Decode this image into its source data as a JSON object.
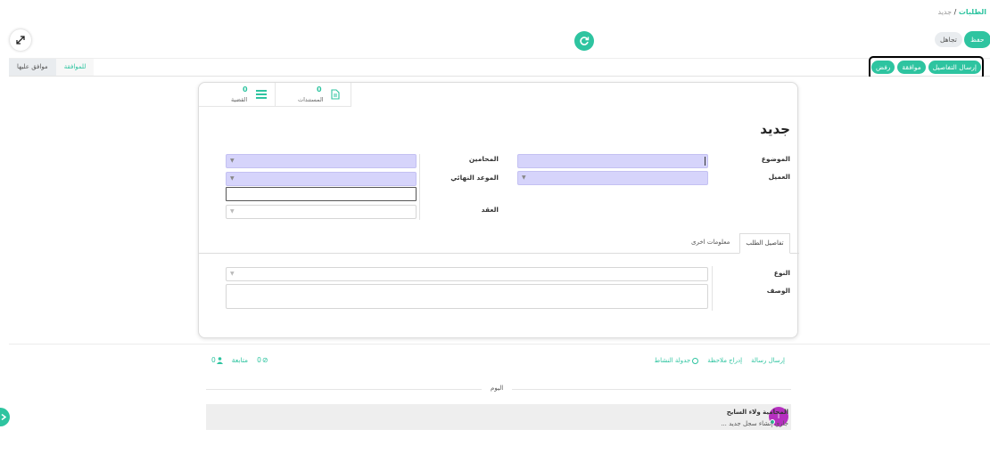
{
  "breadcrumb": {
    "parent": "الطلبات",
    "separator": "/",
    "current": "جديد"
  },
  "toolbar": {
    "save_label": "حفظ",
    "discard_label": "تجاهل"
  },
  "actions": {
    "send_details": "إرسال التفاصيل",
    "approve": "موافقة",
    "reject": "رفض"
  },
  "status": {
    "pending": "للموافقة",
    "approved": "موافق عليها"
  },
  "smart_buttons": [
    {
      "count": "0",
      "label": "المستندات"
    },
    {
      "count": "0",
      "label": "القضية"
    }
  ],
  "form": {
    "title": "جديد",
    "subject_label": "الموضوع",
    "client_label": "العميل",
    "lawyers_label": "المحامين",
    "deadline_label": "الموعد النهائي",
    "contract_label": "العقد"
  },
  "tabs": {
    "request_details": "تفاصيل الطلب",
    "other_info": "معلومات اخرى"
  },
  "details": {
    "type_label": "النوع",
    "description_label": "الوصف"
  },
  "chatter": {
    "send_message": "إرسال رسالة",
    "log_note": "إدراج ملاحظة",
    "schedule_activity": "جدولة النشاط",
    "attachments_count": "0",
    "follow_label": "متابعة",
    "followers_count": "0",
    "today_label": "اليوم",
    "message_author": "المحامية ولاء السايح",
    "message_body": "جاري إنشاء سجل جديد ...",
    "avatar_letter": "ا"
  },
  "colors": {
    "accent": "#2ec4a0",
    "required_field": "#d6d4fb",
    "avatar": "#b52fbf"
  }
}
